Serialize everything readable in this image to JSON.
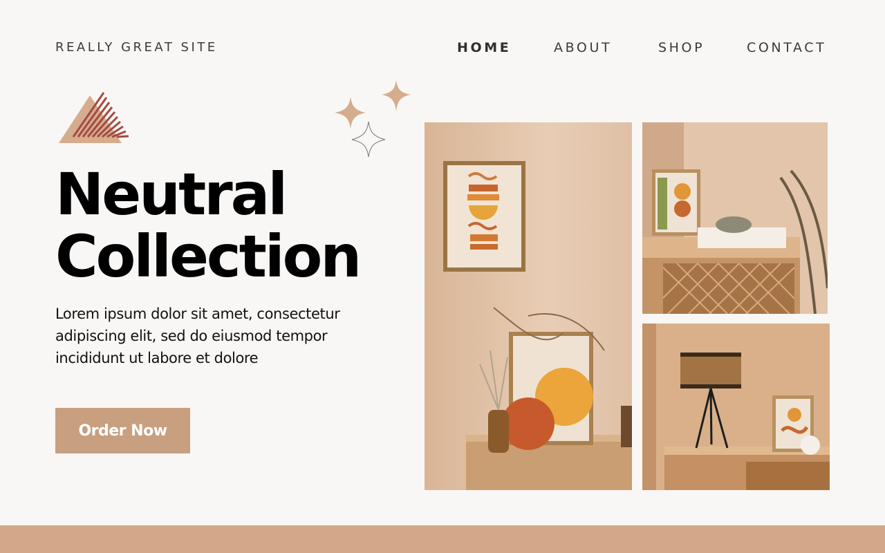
{
  "header": {
    "site_name": "REALLY GREAT SITE",
    "nav": [
      {
        "label": "HOME",
        "active": true
      },
      {
        "label": "ABOUT",
        "active": false
      },
      {
        "label": "SHOP",
        "active": false
      },
      {
        "label": "CONTACT",
        "active": false
      }
    ]
  },
  "hero": {
    "title_line1": "Neutral",
    "title_line2": "Collection",
    "body": "Lorem ipsum dolor sit amet, consectetur adipiscing elit, sed do eiusmod tempor incididunt ut labore et dolore",
    "cta_label": "Order Now"
  },
  "decorations": {
    "logo_icon": "triangle-stripes-icon",
    "sparkle_icon": "sparkles-icon"
  },
  "gallery": {
    "images": [
      "framed-abstract-art-on-wooden-sideboard",
      "framed-art-and-bowl-on-rattan-cabinet",
      "rattan-lamp-and-framed-art-on-sideboard"
    ]
  },
  "colors": {
    "accent": "#c89f7f",
    "footer_bar": "#d2a889",
    "background": "#f9f7f5",
    "logo_stripes": "#a34a43",
    "logo_triangle": "#d6ac8e"
  }
}
